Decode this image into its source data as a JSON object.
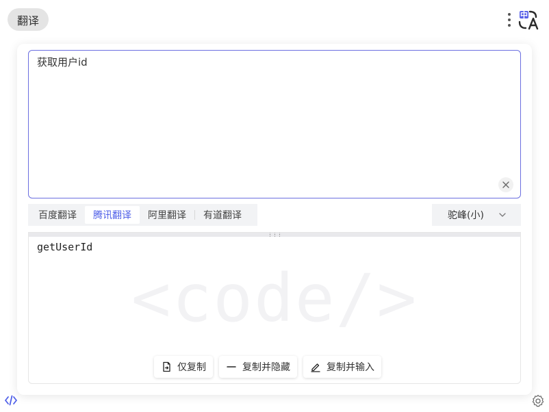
{
  "header": {
    "title": "翻译"
  },
  "input": {
    "value": "获取用户id"
  },
  "tabs": [
    {
      "label": "百度翻译"
    },
    {
      "label": "腾讯翻译"
    },
    {
      "label": "阿里翻译"
    },
    {
      "label": "有道翻译"
    }
  ],
  "active_tab": "腾讯翻译",
  "style_select": {
    "value": "驼峰(小)"
  },
  "output": {
    "value": "getUserId",
    "watermark": "<code/>"
  },
  "actions": {
    "copy_only": "仅复制",
    "copy_hide": "复制并隐藏",
    "copy_input": "复制并输入"
  },
  "colors": {
    "accent": "#4f5fe8",
    "border_active": "#6a6ee0"
  },
  "icons": [
    "more-dots-icon",
    "translate-logo-icon",
    "clear-icon",
    "chevron-down-icon",
    "copy-icon",
    "minus-icon",
    "pen-icon",
    "code-icon",
    "gear-icon"
  ]
}
